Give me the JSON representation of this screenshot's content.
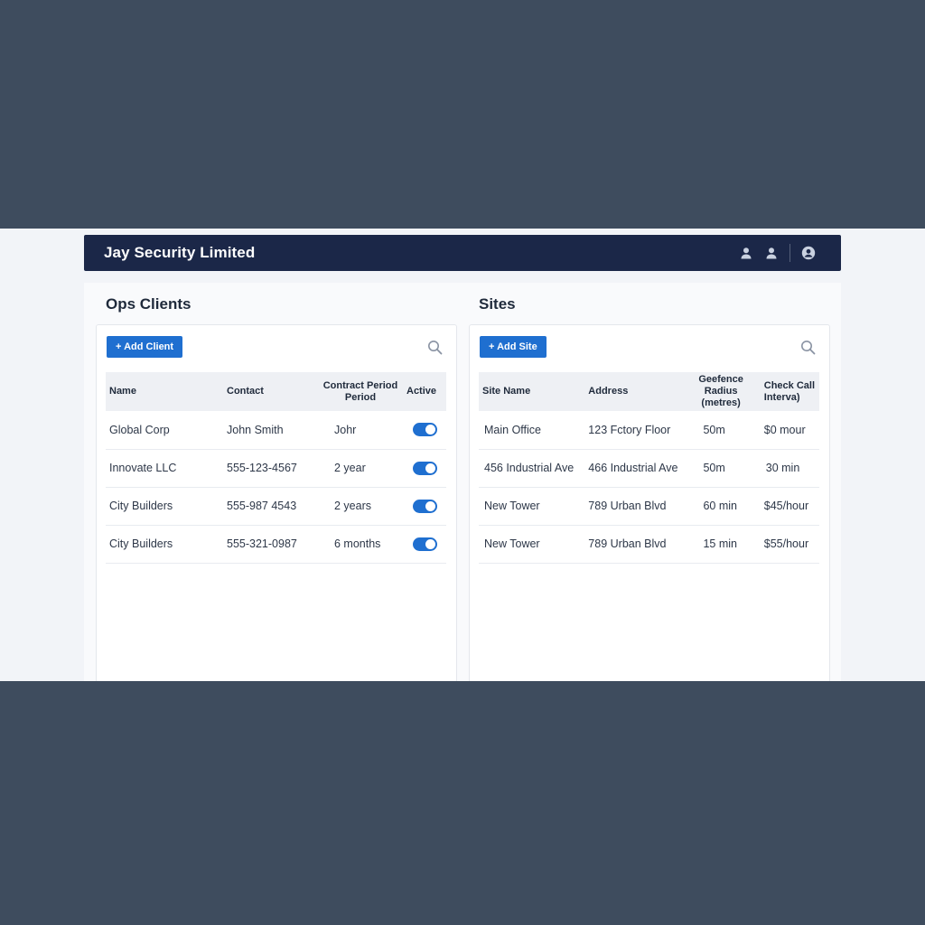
{
  "app": {
    "title": "Jay Security Limited",
    "icons": [
      "user-icon",
      "user-icon",
      "account-circle-icon"
    ]
  },
  "clients": {
    "title": "Ops Clients",
    "add_label": "+ Add Client",
    "columns": [
      "Name",
      "Contact",
      "Contract Period Period",
      "Active"
    ],
    "rows": [
      {
        "name": "Global Corp",
        "contact": "John Smith",
        "period": "Johr",
        "active": true
      },
      {
        "name": "Innovate LLC",
        "contact": "555-123-4567",
        "period": "2 year",
        "active": true
      },
      {
        "name": "City Builders",
        "contact": "555-987 4543",
        "period": "2 years",
        "active": true
      },
      {
        "name": "City Builders",
        "contact": "555-321-0987",
        "period": "6 months",
        "active": true
      }
    ]
  },
  "sites": {
    "title": "Sites",
    "add_label": "+ Add Site",
    "columns": [
      "Site Name",
      "Address",
      "Geefence Radius (metres)",
      "Check Call Interva)"
    ],
    "rows": [
      {
        "site": "Main Office",
        "address": "123 Fctory Floor",
        "radius": "50m",
        "interval": "$0 mour"
      },
      {
        "site": "456 Industrial Ave",
        "address": "466 Industrial Ave",
        "radius": "50m",
        "interval": "30 min"
      },
      {
        "site": "New Tower",
        "address": "789 Urban Blvd",
        "radius": "60 min",
        "interval": "$45/hour"
      },
      {
        "site": "New Tower",
        "address": "789 Urban Blvd",
        "radius": "15 min",
        "interval": "$55/hour"
      }
    ]
  },
  "colors": {
    "appbar": "#1b2748",
    "accent": "#1f6fd0",
    "backdrop": "#3e4c5e"
  }
}
